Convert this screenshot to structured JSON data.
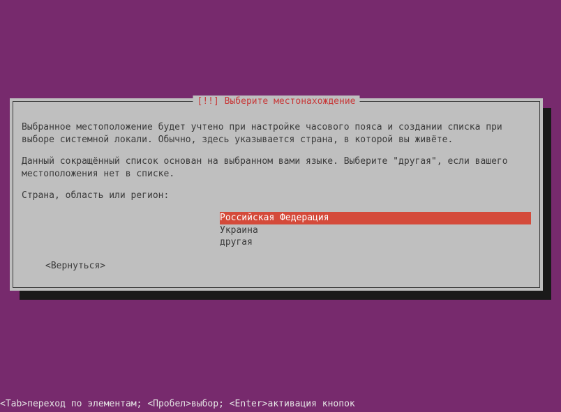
{
  "dialog": {
    "title": "[!!] Выберите местонахождение",
    "paragraph1": "Выбранное местоположение будет учтено при настройке часового пояса и создании списка при выборе системной локали. Обычно, здесь указывается страна, в которой вы живёте.",
    "paragraph2": "Данный сокращённый список основан на выбранном вами языке. Выберите \"другая\", если вашего местоположения нет в списке.",
    "prompt": "Страна, область или регион:",
    "options": [
      {
        "label": "Российская Федерация",
        "selected": true
      },
      {
        "label": "Украина",
        "selected": false
      },
      {
        "label": "другая",
        "selected": false
      }
    ],
    "back_label": "<Вернуться>"
  },
  "footer": "<Tab>переход по элементам; <Пробел>выбор; <Enter>активация кнопок"
}
